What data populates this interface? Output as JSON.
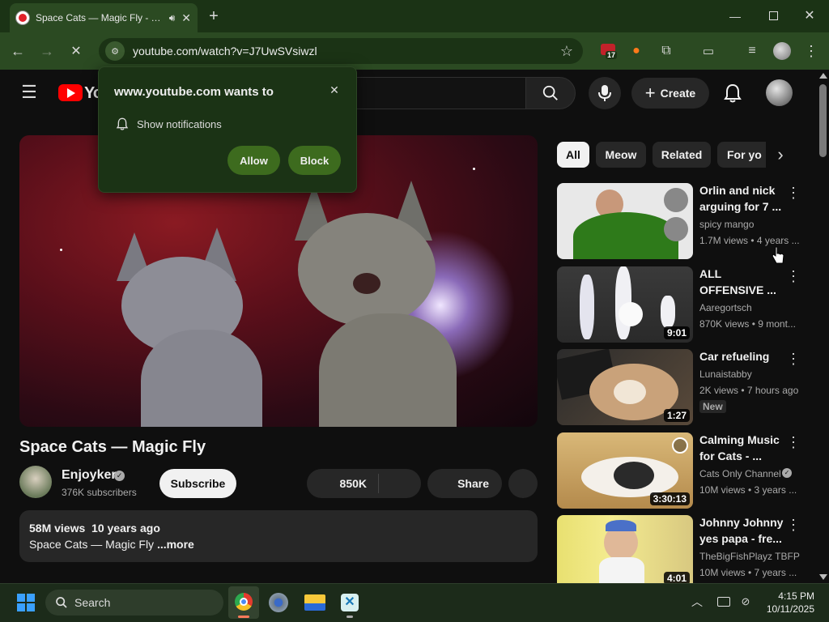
{
  "browser": {
    "tab_title": "Space Cats — Magic Fly - YouTube",
    "address": "youtube.com/watch?v=J7UwSVsiwzl",
    "ext_badge": "17"
  },
  "popup": {
    "title": "www.youtube.com wants to",
    "permission": "Show notifications",
    "allow": "Allow",
    "block": "Block"
  },
  "youtube": {
    "logo_text": "Yo",
    "create": "Create"
  },
  "video": {
    "title": "Space Cats — Magic Fly",
    "channel": "Enjoyker",
    "subscribers": "376K subscribers",
    "subscribe": "Subscribe",
    "likes": "850K",
    "share": "Share",
    "views_date": "58M views  10 years ago",
    "desc": "Space Cats — Magic Fly ",
    "more": "...more"
  },
  "chips": [
    "All",
    "Meow",
    "Related",
    "For yo"
  ],
  "recommendations": [
    {
      "title1": "Orlin and nick",
      "title2": "arguing for 7 ...",
      "channel": "spicy mango",
      "meta": "1.7M views • 4 years ...",
      "duration": "",
      "badge": ""
    },
    {
      "title1": "ALL",
      "title2": "OFFENSIVE ...",
      "channel": "Aaregortsch",
      "meta": "870K views • 9 mont...",
      "duration": "9:01",
      "badge": ""
    },
    {
      "title1": "Car refueling",
      "title2": "",
      "channel": "Lunaistabby",
      "meta": "2K views • 7 hours ago",
      "duration": "1:27",
      "badge": "New"
    },
    {
      "title1": "Calming Music",
      "title2": "for Cats - ...",
      "channel": "Cats Only Channel",
      "meta": "10M views • 3 years ...",
      "duration": "3:30:13",
      "badge": ""
    },
    {
      "title1": "Johnny Johnny",
      "title2": "yes papa - fre...",
      "channel": "TheBigFishPlayz TBFP",
      "meta": "10M views • 7 years ...",
      "duration": "4:01",
      "badge": ""
    }
  ],
  "taskbar": {
    "search": "Search",
    "time": "4:15 PM",
    "date": "10/11/2025"
  },
  "colors": {
    "chrome_dark": "#1b3315",
    "chrome_light": "#2b4a22",
    "popup_button": "#3d6b1e",
    "yt_red": "#ff0000"
  }
}
